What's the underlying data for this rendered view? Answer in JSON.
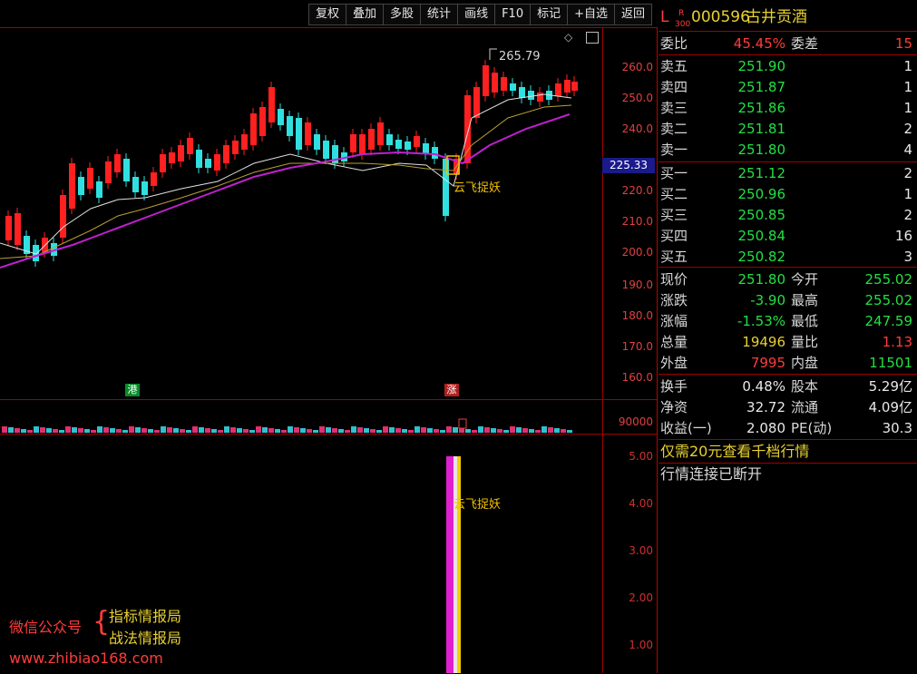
{
  "toolbar": {
    "buttons": [
      "复权",
      "叠加",
      "多股",
      "统计",
      "画线",
      "F10",
      "标记",
      "+自选",
      "返回"
    ]
  },
  "chart": {
    "price_axis": [
      "260.0",
      "250.0",
      "240.0",
      "230.0",
      "220.0",
      "210.0",
      "200.0",
      "190.0",
      "180.0",
      "170.0",
      "160.0"
    ],
    "current_price_tag": "225.33",
    "high_label": "265.79",
    "signal_label": "云飞捉妖",
    "marker_left": "港",
    "marker_right": "涨",
    "volume_axis": "90000",
    "indicator_axis": [
      "5.00",
      "4.00",
      "3.00",
      "2.00",
      "1.00"
    ],
    "indicator_label": "云飞捉妖"
  },
  "quote": {
    "prefix": "L",
    "sup_top": "R",
    "sup_bot": "300",
    "code": "000596",
    "name": "古井贡酒",
    "weibi_label": "委比",
    "weibi_value": "45.45%",
    "weicha_label": "委差",
    "weicha_value": "15",
    "asks": [
      {
        "label": "卖五",
        "price": "251.90",
        "vol": "1"
      },
      {
        "label": "卖四",
        "price": "251.87",
        "vol": "1"
      },
      {
        "label": "卖三",
        "price": "251.86",
        "vol": "1"
      },
      {
        "label": "卖二",
        "price": "251.81",
        "vol": "2"
      },
      {
        "label": "卖一",
        "price": "251.80",
        "vol": "4"
      }
    ],
    "bids": [
      {
        "label": "买一",
        "price": "251.12",
        "vol": "2"
      },
      {
        "label": "买二",
        "price": "250.96",
        "vol": "1"
      },
      {
        "label": "买三",
        "price": "250.85",
        "vol": "2"
      },
      {
        "label": "买四",
        "price": "250.84",
        "vol": "16"
      },
      {
        "label": "买五",
        "price": "250.82",
        "vol": "3"
      }
    ],
    "stats": [
      {
        "l1": "现价",
        "v1": "251.80",
        "c1": "green",
        "l2": "今开",
        "v2": "255.02",
        "c2": "green"
      },
      {
        "l1": "涨跌",
        "v1": "-3.90",
        "c1": "green",
        "l2": "最高",
        "v2": "255.02",
        "c2": "green"
      },
      {
        "l1": "涨幅",
        "v1": "-1.53%",
        "c1": "green",
        "l2": "最低",
        "v2": "247.59",
        "c2": "green"
      },
      {
        "l1": "总量",
        "v1": "19496",
        "c1": "yellow",
        "l2": "量比",
        "v2": "1.13",
        "c2": "red"
      },
      {
        "l1": "外盘",
        "v1": "7995",
        "c1": "red",
        "l2": "内盘",
        "v2": "11501",
        "c2": "green"
      }
    ],
    "fin": [
      {
        "l1": "换手",
        "v1": "0.48%",
        "l2": "股本",
        "v2": "5.29亿"
      },
      {
        "l1": "净资",
        "v1": "32.72",
        "l2": "流通",
        "v2": "4.09亿"
      },
      {
        "l1": "收益(一)",
        "v1": "2.080",
        "l2": "PE(动)",
        "v2": "30.3"
      }
    ],
    "promo": "仅需20元查看千档行情",
    "status": "行情连接已断开"
  },
  "watermark": {
    "left": "微信公众号",
    "line1": "指标情报局",
    "line2": "战法情报局",
    "url": "www.zhibiao168.com"
  }
}
